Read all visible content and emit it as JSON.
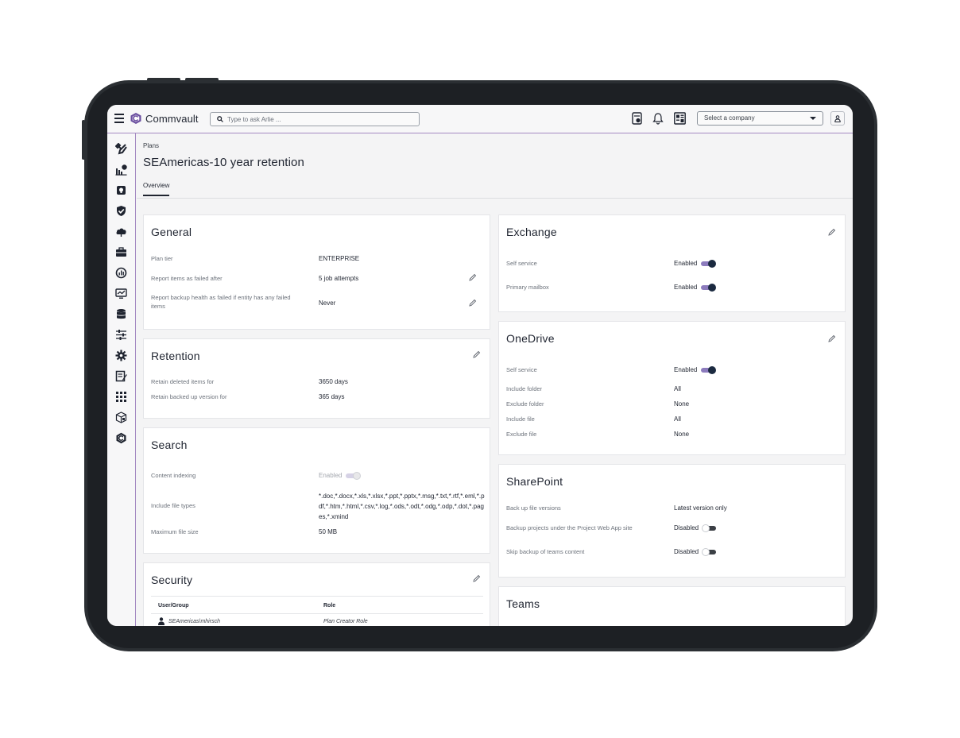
{
  "topbar": {
    "brand": "Commvault",
    "search_placeholder": "Type to ask Arlie ...",
    "company_select": "Select a company"
  },
  "breadcrumb": "Plans",
  "page_title": "SEAmericas-10 year retention",
  "tabs": [
    {
      "label": "Overview",
      "active": true
    }
  ],
  "general": {
    "title": "General",
    "rows": [
      {
        "label": "Plan tier",
        "value": "ENTERPRISE"
      },
      {
        "label": "Report items as failed after",
        "value": "5 job attempts"
      },
      {
        "label": "Report backup health as failed if entity has any failed items",
        "value": "Never"
      }
    ]
  },
  "retention": {
    "title": "Retention",
    "rows": [
      {
        "label": "Retain deleted items for",
        "value": "3650 days"
      },
      {
        "label": "Retain backed up version for",
        "value": "365 days"
      }
    ]
  },
  "search": {
    "title": "Search",
    "rows": [
      {
        "label": "Content indexing",
        "value": "Enabled",
        "toggle": "disabled-on"
      },
      {
        "label": "Include file types",
        "value": "*.doc,*.docx,*.xls,*.xlsx,*.ppt,*.pptx,*.msg,*.txt,*.rtf,*.eml,*.pdf,*.htm,*.html,*.csv,*.log,*.ods,*.odt,*.odg,*.odp,*.dot,*.pages,*.xmind"
      },
      {
        "label": "Maximum file size",
        "value": "50 MB"
      }
    ]
  },
  "security": {
    "title": "Security",
    "columns": [
      "User/Group",
      "Role"
    ],
    "rows": [
      {
        "user": "SEAmericas\\mhirsch",
        "role": "Plan Creator Role"
      }
    ]
  },
  "exchange": {
    "title": "Exchange",
    "rows": [
      {
        "label": "Self service",
        "value": "Enabled",
        "toggle": "on"
      },
      {
        "label": "Primary mailbox",
        "value": "Enabled",
        "toggle": "on"
      }
    ]
  },
  "onedrive": {
    "title": "OneDrive",
    "rows": [
      {
        "label": "Self service",
        "value": "Enabled",
        "toggle": "on"
      },
      {
        "label": "Include folder",
        "value": "All"
      },
      {
        "label": "Exclude folder",
        "value": "None"
      },
      {
        "label": "Include file",
        "value": "All"
      },
      {
        "label": "Exclude file",
        "value": "None"
      }
    ]
  },
  "sharepoint": {
    "title": "SharePoint",
    "rows": [
      {
        "label": "Back up file versions",
        "value": "Latest version only"
      },
      {
        "label": "Backup projects under the Project Web App site",
        "value": "Disabled",
        "toggle": "off"
      },
      {
        "label": "Skip backup of teams content",
        "value": "Disabled",
        "toggle": "off"
      }
    ]
  },
  "teams": {
    "title": "Teams"
  },
  "colors": {
    "accent": "#8c7bbd",
    "border_accent": "#a48ac2",
    "toggle_knob": "#1b2a40",
    "background": "#f4f4f5"
  }
}
